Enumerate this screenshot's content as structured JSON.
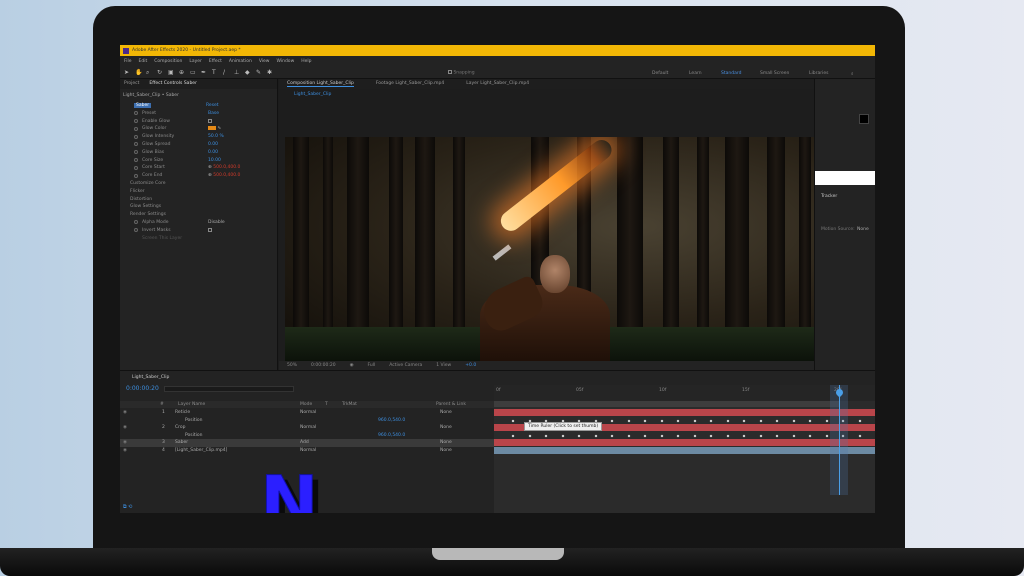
{
  "app": {
    "title": "Adobe After Effects 2020 - Untitled Project.aep *",
    "menu": [
      "File",
      "Edit",
      "Composition",
      "Layer",
      "Effect",
      "Animation",
      "View",
      "Window",
      "Help"
    ],
    "toolbar_snapping": "Snapping",
    "workspaces": [
      {
        "label": "Default",
        "active": false
      },
      {
        "label": "Learn",
        "active": false
      },
      {
        "label": "Standard",
        "active": true
      },
      {
        "label": "Small Screen",
        "active": false
      },
      {
        "label": "Libraries",
        "active": false
      }
    ]
  },
  "effect_panel": {
    "tabs": [
      "Project",
      "Effect Controls Saber"
    ],
    "layer_path": "Light_Saber_Clip • Saber",
    "effect_name": "Saber",
    "reset_label": "Reset",
    "rows": [
      {
        "label": "Preset",
        "value": "Base"
      },
      {
        "label": "Enable Glow",
        "value": ""
      },
      {
        "label": "Glow Color",
        "value": ""
      },
      {
        "label": "Glow Intensity",
        "value": "50.0 %"
      },
      {
        "label": "Glow Spread",
        "value": "0.00"
      },
      {
        "label": "Glow Bias",
        "value": "0.00"
      },
      {
        "label": "Core Size",
        "value": "10.00"
      },
      {
        "label": "Core Start",
        "value": "500.0,400.0"
      },
      {
        "label": "Core End",
        "value": "500.0,400.0"
      },
      {
        "label": "Customize Core",
        "value": ""
      },
      {
        "label": "Flicker",
        "value": ""
      },
      {
        "label": "Distortion",
        "value": ""
      },
      {
        "label": "Glow Settings",
        "value": ""
      },
      {
        "label": "Render Settings",
        "value": ""
      },
      {
        "label": "Alpha Mode",
        "value": "Disable"
      },
      {
        "label": "Invert Masks",
        "value": ""
      },
      {
        "label": "Screen This Layer",
        "value": ""
      }
    ]
  },
  "composition": {
    "tabs": [
      "Composition Light_Saber_Clip",
      "Footage Light_Saber_Clip.mp4",
      "Layer Light_Saber_Clip.mp4"
    ],
    "subtab": "Light_Saber_Clip",
    "viewer_bar": [
      "50%",
      "0:00:00:20",
      "Full",
      "Active Camera",
      "1 View",
      "+0.0"
    ]
  },
  "right_panel": {
    "tracker_label": "Tracker",
    "motion_source": "Motion Source:",
    "motion_source_value": "None"
  },
  "timeline": {
    "tab": "Light_Saber_Clip",
    "timecode": "0:00:00:20",
    "search_placeholder": "🔍",
    "headers": [
      "#",
      "Layer Name",
      "Mode",
      "T",
      "TrkMat",
      "Parent & Link"
    ],
    "layers": [
      {
        "index": "1",
        "name": "Reticle",
        "mode": "Normal",
        "parent": "None",
        "color": "#d9d9d9"
      },
      {
        "index": "",
        "name": "Position",
        "mode": "",
        "parent": "",
        "color": ""
      },
      {
        "index": "2",
        "name": "Crop",
        "mode": "Normal",
        "parent": "None",
        "color": "#d9d9d9"
      },
      {
        "index": "",
        "name": "Position",
        "mode": "",
        "parent": "",
        "color": ""
      },
      {
        "index": "3",
        "name": "Saber",
        "mode": "Add",
        "parent": "None",
        "color": "#c23b3b"
      },
      {
        "index": "4",
        "name": "[Light_Saber_Clip.mp4]",
        "mode": "Normal",
        "parent": "None",
        "color": "#7ea6c8"
      }
    ],
    "ruler": [
      "0f",
      "05f",
      "10f",
      "15f",
      "20f"
    ],
    "tooltip": "Time Ruler (Click to set thumb)"
  },
  "overlay_logo": "N"
}
